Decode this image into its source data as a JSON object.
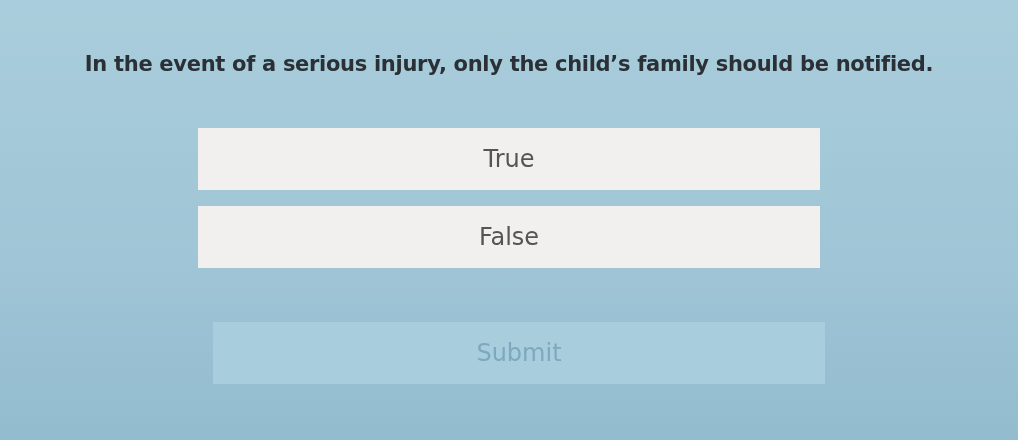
{
  "question": "In the event of a serious injury, only the child’s family should be notified.",
  "options": [
    {
      "label": "True",
      "selected": false
    },
    {
      "label": "False",
      "selected": false
    }
  ],
  "submit": {
    "label": "Submit",
    "disabled": true
  }
}
